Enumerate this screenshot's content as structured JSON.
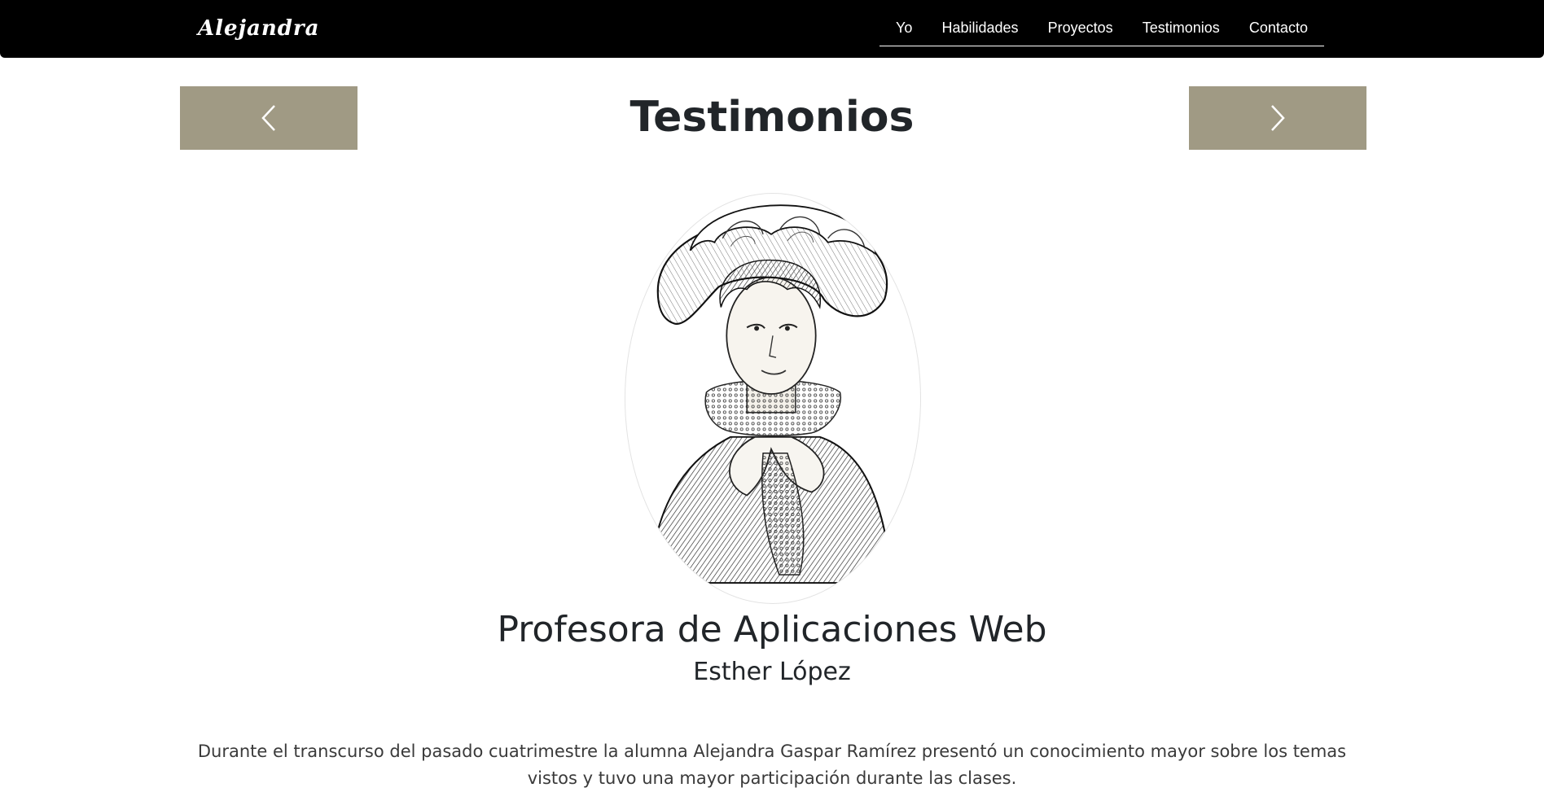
{
  "navbar": {
    "brand": "Alejandra",
    "links": [
      "Yo",
      "Habilidades",
      "Proyectos",
      "Testimonios",
      "Contacto"
    ]
  },
  "testimonials": {
    "title": "Testimonios",
    "prev_icon": "chevron-left-icon",
    "next_icon": "chevron-right-icon",
    "accent_color": "#a09a84",
    "role": "Profesora de Aplicaciones Web",
    "name": "Esther López",
    "quote": "Durante el transcurso del pasado cuatrimestre la alumna Alejandra Gaspar Ramírez presentó un conocimiento mayor sobre los temas vistos y tuvo una mayor participación durante las clases."
  }
}
